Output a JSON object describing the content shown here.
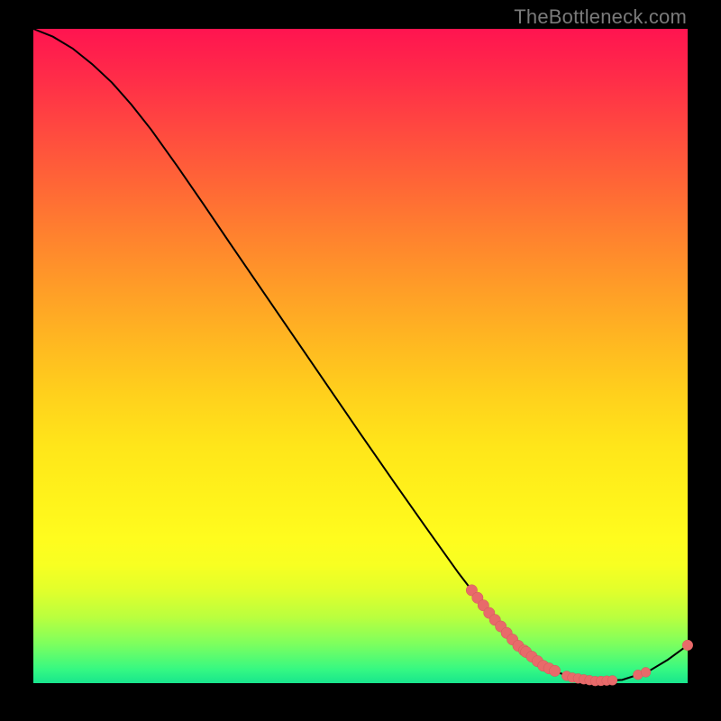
{
  "watermark": "TheBottleneck.com",
  "colors": {
    "curve": "#000000",
    "marker_fill": "#e86a6a",
    "marker_stroke": "#cf5a5a"
  },
  "chart_data": {
    "type": "line",
    "xlim": [
      0,
      100
    ],
    "ylim": [
      0,
      100
    ],
    "title": "",
    "xlabel": "",
    "ylabel": "",
    "curve": [
      {
        "x": 0,
        "y": 100.0
      },
      {
        "x": 3,
        "y": 98.8
      },
      {
        "x": 6,
        "y": 97.0
      },
      {
        "x": 9,
        "y": 94.6
      },
      {
        "x": 12,
        "y": 91.8
      },
      {
        "x": 15,
        "y": 88.4
      },
      {
        "x": 18,
        "y": 84.6
      },
      {
        "x": 22,
        "y": 79.0
      },
      {
        "x": 26,
        "y": 73.2
      },
      {
        "x": 30,
        "y": 67.3
      },
      {
        "x": 35,
        "y": 60.0
      },
      {
        "x": 40,
        "y": 52.7
      },
      {
        "x": 45,
        "y": 45.4
      },
      {
        "x": 50,
        "y": 38.1
      },
      {
        "x": 55,
        "y": 30.9
      },
      {
        "x": 60,
        "y": 23.8
      },
      {
        "x": 65,
        "y": 16.8
      },
      {
        "x": 70,
        "y": 10.3
      },
      {
        "x": 74,
        "y": 5.8
      },
      {
        "x": 78,
        "y": 2.6
      },
      {
        "x": 82,
        "y": 0.9
      },
      {
        "x": 86,
        "y": 0.3
      },
      {
        "x": 90,
        "y": 0.5
      },
      {
        "x": 94,
        "y": 1.8
      },
      {
        "x": 97,
        "y": 3.6
      },
      {
        "x": 100,
        "y": 5.8
      }
    ],
    "marker_clusters": [
      {
        "center_x": 71.0,
        "spread": 4.0,
        "count": 10,
        "radius": 6.2
      },
      {
        "center_x": 77.5,
        "spread": 2.2,
        "count": 6,
        "radius": 6.2
      },
      {
        "center_x": 85.0,
        "spread": 3.5,
        "count": 9,
        "radius": 5.4
      },
      {
        "center_x": 93.0,
        "spread": 0.6,
        "count": 2,
        "radius": 5.4
      },
      {
        "center_x": 100.0,
        "spread": 0.0,
        "count": 1,
        "radius": 5.8
      }
    ]
  }
}
